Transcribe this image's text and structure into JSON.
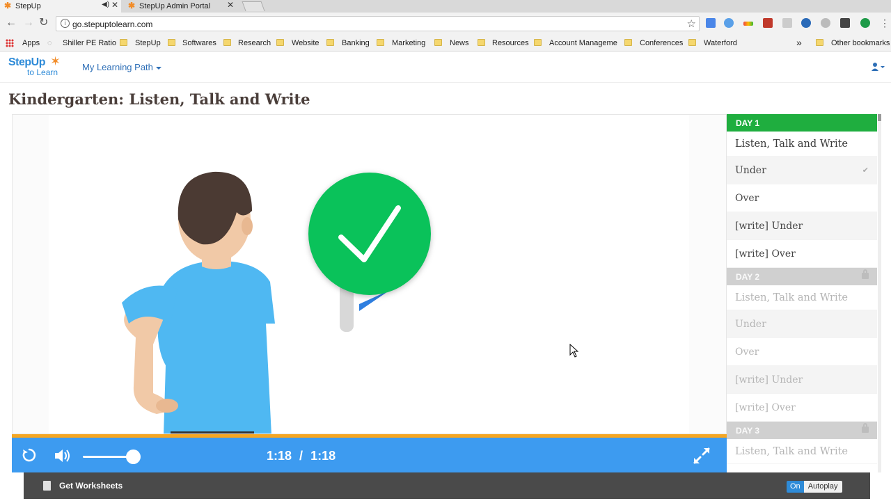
{
  "browser": {
    "tabs": [
      {
        "title": "StepUp",
        "active": true
      },
      {
        "title": "StepUp Admin Portal",
        "active": false
      }
    ],
    "url": "go.stepuptolearn.com",
    "bookmarks": [
      "Apps",
      "Shiller PE Ratio",
      "StepUp",
      "Softwares",
      "Research",
      "Website",
      "Banking",
      "Marketing",
      "News",
      "Resources",
      "Account Manageme",
      "Conferences",
      "Waterford"
    ],
    "overflow_label": "»",
    "other_bookmarks": "Other bookmarks"
  },
  "site": {
    "logo_top": "StepUp",
    "logo_bottom": "to Learn",
    "nav_label": "My Learning Path"
  },
  "page": {
    "title": "Kindergarten: Listen, Talk and Write"
  },
  "player": {
    "time_current": "1:18",
    "time_sep": "/",
    "time_total": "1:18",
    "progress": 1.0,
    "volume": 0.9
  },
  "playlist": {
    "days": [
      {
        "label": "DAY 1",
        "locked": false,
        "items": [
          {
            "label": "Listen, Talk and Write",
            "completed": false
          },
          {
            "label": "Under",
            "completed": true
          },
          {
            "label": "Over",
            "completed": false
          },
          {
            "label": "[write] Under",
            "completed": false
          },
          {
            "label": "[write] Over",
            "completed": false
          }
        ]
      },
      {
        "label": "DAY 2",
        "locked": true,
        "items": [
          {
            "label": "Listen, Talk and Write"
          },
          {
            "label": "Under"
          },
          {
            "label": "Over"
          },
          {
            "label": "[write] Under"
          },
          {
            "label": "[write] Over"
          }
        ]
      },
      {
        "label": "DAY 3",
        "locked": true,
        "items": [
          {
            "label": "Listen, Talk and Write"
          }
        ]
      }
    ]
  },
  "footer": {
    "worksheets_label": "Get Worksheets",
    "autoplay_state": "On",
    "autoplay_label": "Autoplay"
  },
  "colors": {
    "accent_blue": "#3d9bf0",
    "progress_orange": "#f5a623",
    "day_active_green": "#1fae3f",
    "check_green": "#0ac25a",
    "shirt_blue": "#4fb8f2"
  }
}
